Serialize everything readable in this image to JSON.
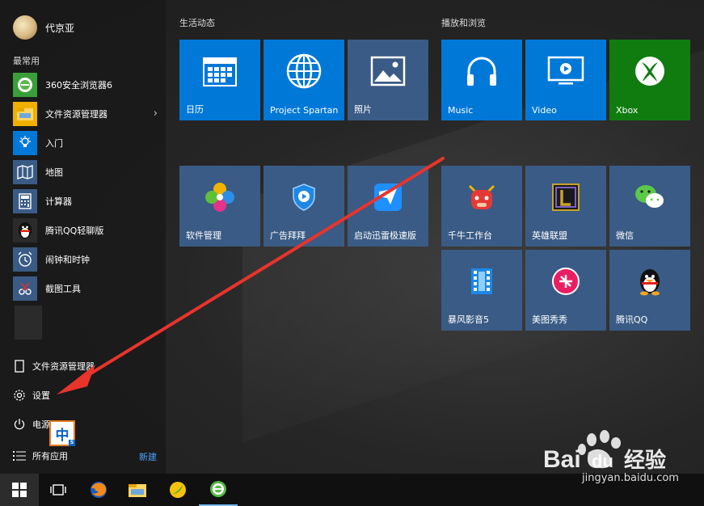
{
  "user": {
    "name": "代京亚"
  },
  "most_used": {
    "label": "最常用",
    "apps": [
      {
        "label": "360安全浏览器6",
        "icon": "360-browser-icon"
      },
      {
        "label": "文件资源管理器",
        "icon": "folder-icon",
        "has_submenu": true
      },
      {
        "label": "入门",
        "icon": "lightbulb-icon"
      },
      {
        "label": "地图",
        "icon": "map-icon"
      },
      {
        "label": "计算器",
        "icon": "calculator-icon"
      },
      {
        "label": "腾讯QQ轻聊版",
        "icon": "qq-penguin-icon"
      },
      {
        "label": "闹钟和时钟",
        "icon": "alarm-clock-icon"
      },
      {
        "label": "截图工具",
        "icon": "snipping-tool-icon"
      }
    ]
  },
  "bottom": {
    "file_explorer": "文件资源管理器",
    "settings": "设置",
    "power": "电源",
    "all_apps": "所有应用",
    "new": "新建"
  },
  "ime": {
    "label": "中",
    "sub": "S"
  },
  "groups": {
    "live": {
      "label": "生活动态"
    },
    "media": {
      "label": "播放和浏览"
    }
  },
  "tiles": {
    "calendar": "日历",
    "spartan": "Project Spartan",
    "photos": "照片",
    "music": "Music",
    "video": "Video",
    "xbox": "Xbox",
    "software": "软件管理",
    "adblock": "广告拜拜",
    "thunder": "启动迅雷极速版",
    "qianniu": "千牛工作台",
    "lol": "英雄联盟",
    "wechat": "微信",
    "storm": "暴风影音5",
    "meitu": "美图秀秀",
    "qq": "腾讯QQ"
  },
  "watermark": {
    "text": "jingyan.baidu.com",
    "brand": "Bai",
    "brand2": "du",
    "brand3": "经验"
  },
  "colors": {
    "tile_blue": "#0078d7",
    "tile_slate": "#3a5b85",
    "xbox_green": "#107c10",
    "arrow_red": "#e8342c"
  }
}
